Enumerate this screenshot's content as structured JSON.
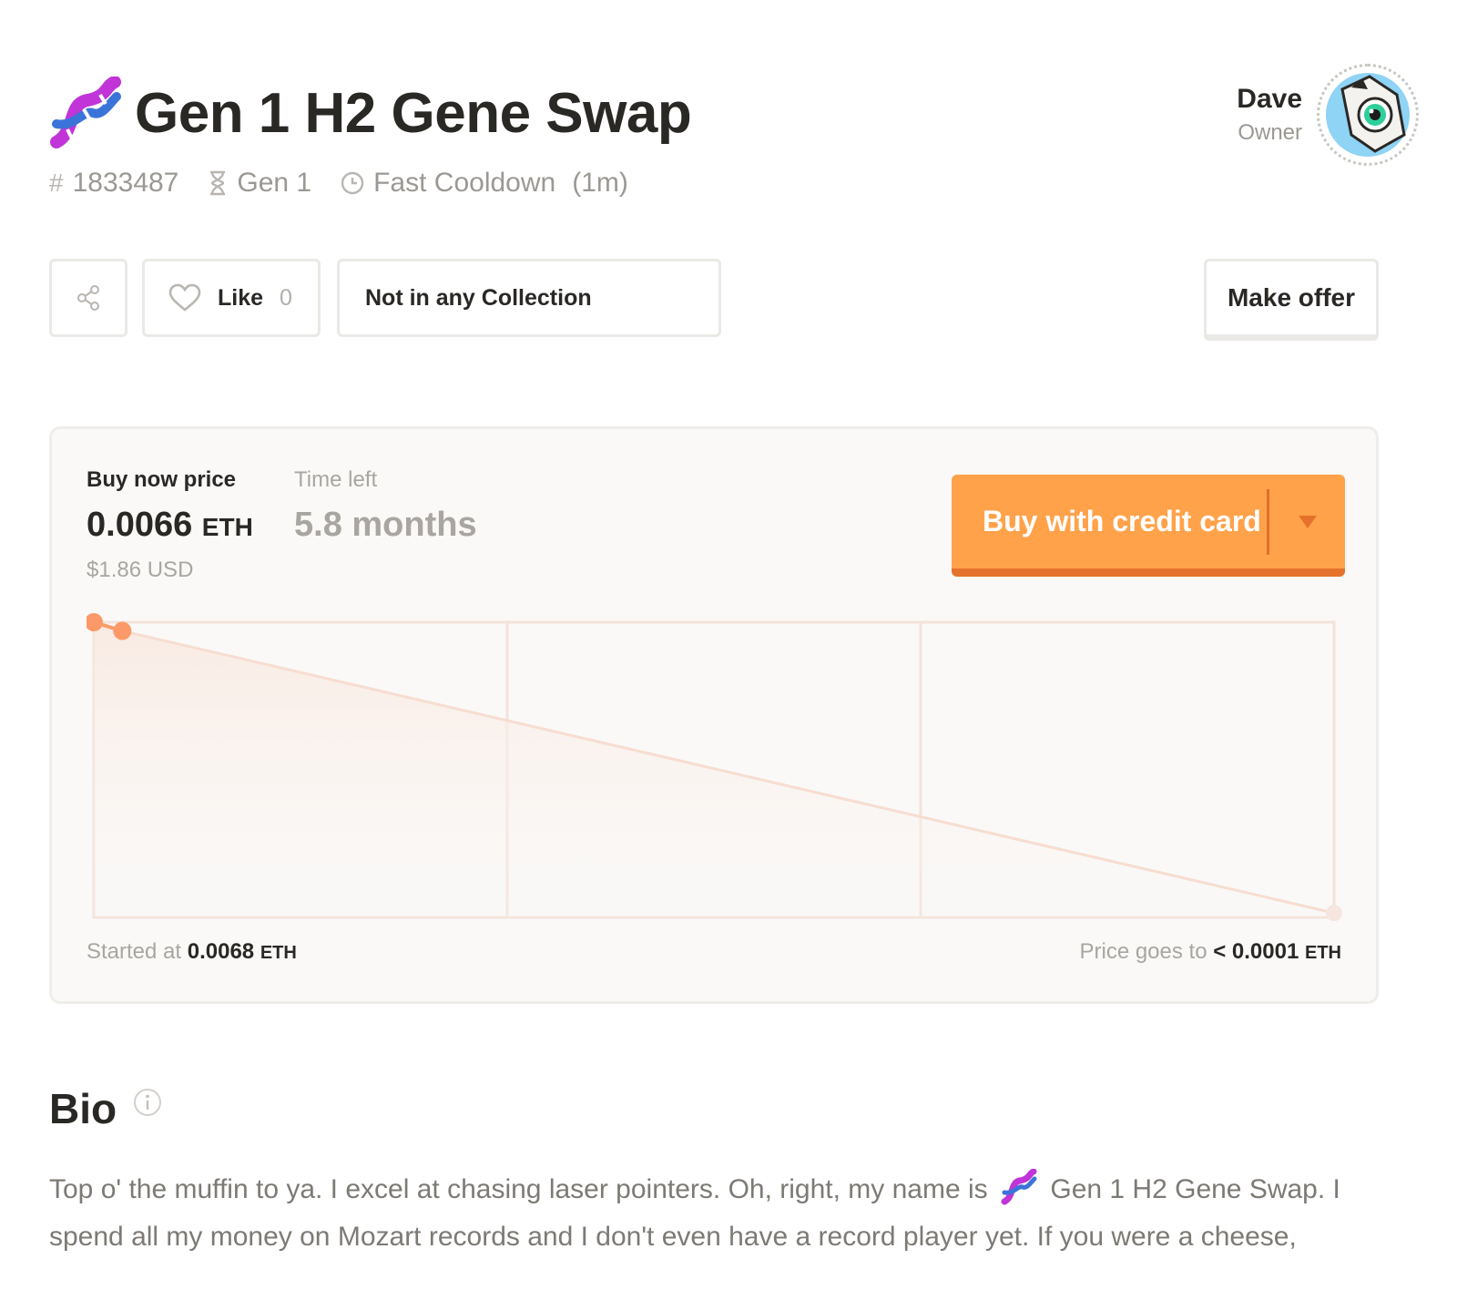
{
  "header": {
    "title": "Gen 1 H2 Gene Swap",
    "id_prefix": "#",
    "id": "1833487",
    "generation": "Gen 1",
    "cooldown": "Fast Cooldown",
    "cooldown_time": "(1m)"
  },
  "owner": {
    "name": "Dave",
    "role": "Owner"
  },
  "actions": {
    "like_label": "Like",
    "like_count": "0",
    "collection_label": "Not in any Collection",
    "offer_label": "Make offer"
  },
  "sale": {
    "buy_now_label": "Buy now price",
    "price": "0.0066",
    "price_unit": "ETH",
    "usd": "$1.86 USD",
    "time_left_label": "Time left",
    "time_left": "5.8 months",
    "buy_button": "Buy with credit card",
    "started_label": "Started at",
    "started_value": "0.0068",
    "started_unit": "ETH",
    "goes_to_label": "Price goes to",
    "goes_to_value": "< 0.0001",
    "goes_to_unit": "ETH"
  },
  "chart_data": {
    "type": "line",
    "x": [
      0,
      0.023,
      1
    ],
    "y": [
      0.0068,
      0.0066,
      0.0001
    ],
    "ylim": [
      0,
      0.0068
    ],
    "xlim": [
      0,
      1
    ],
    "grid": true
  },
  "bio": {
    "title": "Bio",
    "text_before": "Top o' the muffin to ya. I excel at chasing laser pointers. Oh, right, my name is",
    "text_after": "Gen 1 H2 Gene Swap. I spend all my money on Mozart records and I don't even have a record player yet. If you were a cheese,"
  },
  "colors": {
    "accent": "#ffa24a",
    "accent_dark": "#e5722c",
    "chart_line": "#f7ddd0",
    "chart_point": "#fb9a68"
  }
}
